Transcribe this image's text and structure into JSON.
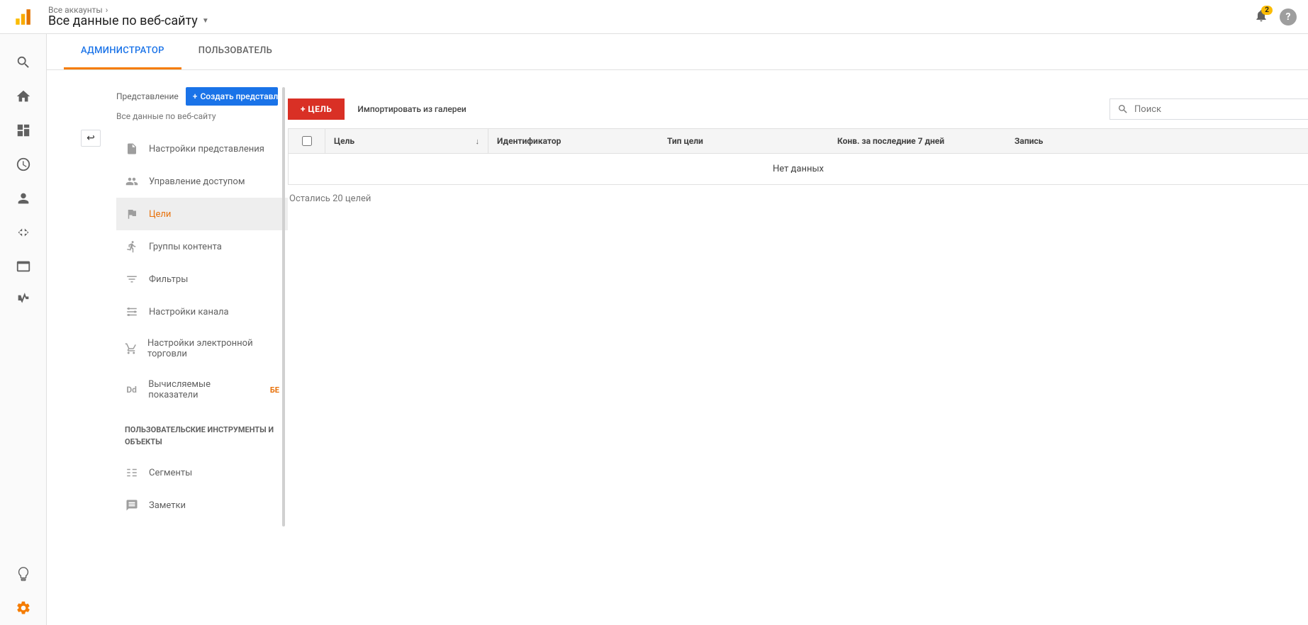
{
  "header": {
    "breadcrumb_all_accounts": "Все аккаунты",
    "breadcrumb_sep": "›",
    "view_title": "Все данные по веб-сайту",
    "notif_count": "2"
  },
  "tabs": {
    "admin": "АДМИНИСТРАТОР",
    "user": "ПОЛЬЗОВАТЕЛЬ"
  },
  "sidebar": {
    "column_label": "Представление",
    "create_btn": "Создать представление",
    "view_name": "Все данные по веб-сайту",
    "items": [
      {
        "label": "Настройки представления"
      },
      {
        "label": "Управление доступом"
      },
      {
        "label": "Цели"
      },
      {
        "label": "Группы контента"
      },
      {
        "label": "Фильтры"
      },
      {
        "label": "Настройки канала"
      },
      {
        "label": "Настройки электронной торговли"
      },
      {
        "label": "Вычисляемые показатели"
      }
    ],
    "beta_label": "БЕ",
    "section_heading": "ПОЛЬЗОВАТЕЛЬСКИЕ ИНСТРУМЕНТЫ И ОБЪЕКТЫ",
    "items2": [
      {
        "label": "Сегменты"
      },
      {
        "label": "Заметки"
      }
    ]
  },
  "goals": {
    "add_goal": "+ ЦЕЛЬ",
    "import_gallery": "Импортировать из галереи",
    "search_placeholder": "Поиск",
    "columns": {
      "goal": "Цель",
      "id": "Идентификатор",
      "type": "Тип цели",
      "conv": "Конв. за последние 7 дней",
      "rec": "Запись"
    },
    "no_data": "Нет данных",
    "remaining": "Остались 20 целей"
  }
}
